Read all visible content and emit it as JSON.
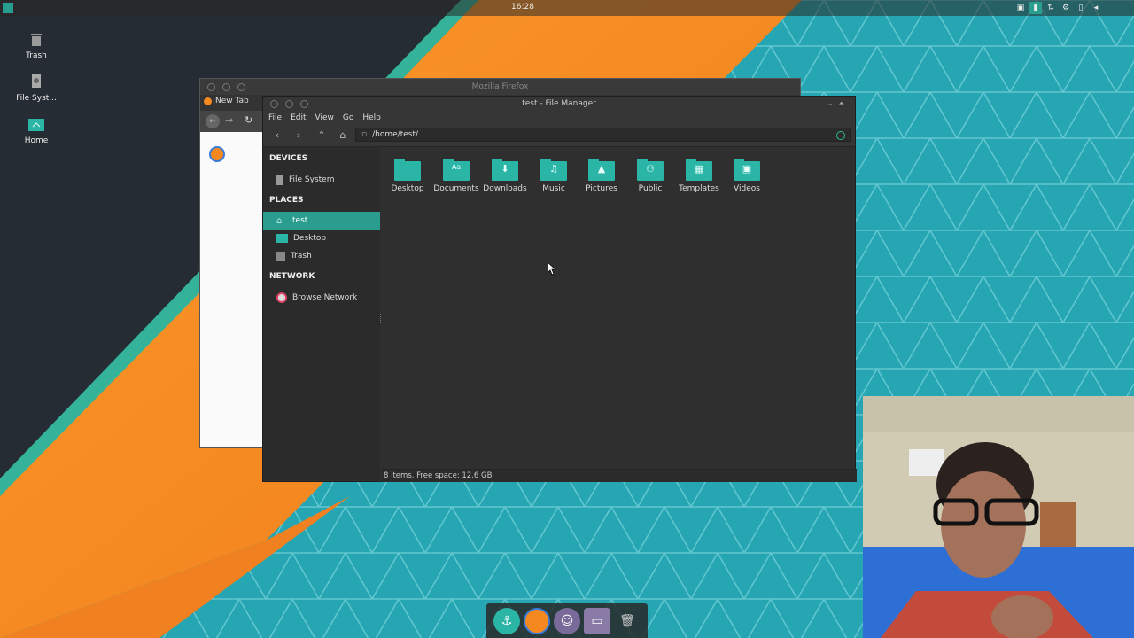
{
  "top_panel": {
    "clock": "16:28",
    "tray_icons": [
      "monitor-icon",
      "display-icon",
      "network-arrows-icon",
      "settings-gear-icon",
      "battery-icon",
      "volume-icon",
      "power-icon"
    ]
  },
  "desktop_icons": [
    {
      "label": "Trash",
      "icon": "trash-icon"
    },
    {
      "label": "File Syst...",
      "icon": "drive-icon"
    },
    {
      "label": "Home",
      "icon": "home-folder-icon"
    }
  ],
  "firefox": {
    "title": "Mozilla Firefox",
    "tab_label": "New Tab"
  },
  "file_manager": {
    "title": "test - File Manager",
    "menu": [
      "File",
      "Edit",
      "View",
      "Go",
      "Help"
    ],
    "address": "/home/test/",
    "sidebar": {
      "devices_header": "DEVICES",
      "devices": [
        {
          "label": "File System",
          "icon": "drive-icon"
        }
      ],
      "places_header": "PLACES",
      "places": [
        {
          "label": "test",
          "icon": "home-icon",
          "active": true
        },
        {
          "label": "Desktop",
          "icon": "desktop-icon"
        },
        {
          "label": "Trash",
          "icon": "trash-icon"
        }
      ],
      "network_header": "NETWORK",
      "network": [
        {
          "label": "Browse Network",
          "icon": "network-icon"
        }
      ]
    },
    "folders": [
      {
        "label": "Desktop",
        "icon": "desktop-folder-icon",
        "symbol": ""
      },
      {
        "label": "Documents",
        "icon": "documents-folder-icon",
        "symbol": "Aa"
      },
      {
        "label": "Downloads",
        "icon": "downloads-folder-icon",
        "symbol": "⬇"
      },
      {
        "label": "Music",
        "icon": "music-folder-icon",
        "symbol": "♫"
      },
      {
        "label": "Pictures",
        "icon": "pictures-folder-icon",
        "symbol": "▲"
      },
      {
        "label": "Public",
        "icon": "public-folder-icon",
        "symbol": "⚇"
      },
      {
        "label": "Templates",
        "icon": "templates-folder-icon",
        "symbol": "▦"
      },
      {
        "label": "Videos",
        "icon": "videos-folder-icon",
        "symbol": "▣"
      }
    ],
    "status": "8 items, Free space: 12.6 GB"
  },
  "dock": [
    "anchor-icon",
    "firefox-icon",
    "pidgin-icon",
    "file-manager-icon",
    "trash-icon"
  ],
  "colors": {
    "accent": "#2a9d8f",
    "orange": "#f5891f",
    "teal_bg": "#27a7b5"
  }
}
